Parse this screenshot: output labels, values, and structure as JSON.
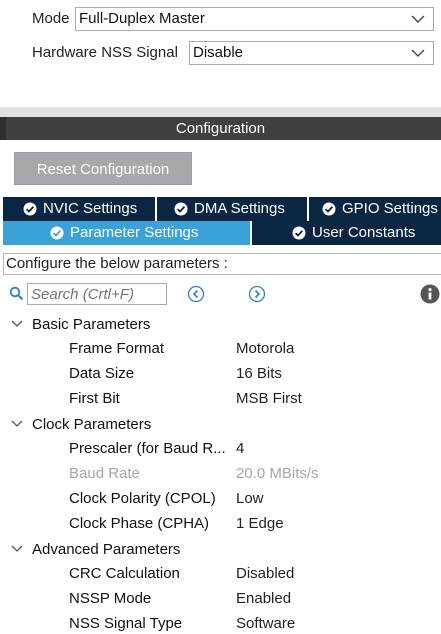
{
  "mode": {
    "label": "Mode",
    "value": "Full-Duplex Master"
  },
  "nss": {
    "label": "Hardware NSS Signal",
    "value": "Disable"
  },
  "configuration": {
    "title": "Configuration",
    "reset_label": "Reset Configuration"
  },
  "tabs": {
    "row1": [
      {
        "label": "NVIC Settings"
      },
      {
        "label": "DMA Settings"
      },
      {
        "label": "GPIO Settings"
      }
    ],
    "row2": [
      {
        "label": "Parameter Settings",
        "active": true
      },
      {
        "label": "User Constants"
      }
    ]
  },
  "description": "Configure the below parameters :",
  "search": {
    "placeholder": "Search (Crtl+F)"
  },
  "groups": [
    {
      "name": "Basic Parameters",
      "params": [
        {
          "name": "Frame Format",
          "value": "Motorola"
        },
        {
          "name": "Data Size",
          "value": "16 Bits"
        },
        {
          "name": "First Bit",
          "value": "MSB First"
        }
      ]
    },
    {
      "name": "Clock Parameters",
      "params": [
        {
          "name": "Prescaler (for Baud R...",
          "value": "4"
        },
        {
          "name": "Baud Rate",
          "value": "20.0 MBits/s",
          "disabled": true
        },
        {
          "name": "Clock Polarity (CPOL)",
          "value": "Low"
        },
        {
          "name": "Clock Phase (CPHA)",
          "value": "1 Edge"
        }
      ]
    },
    {
      "name": "Advanced Parameters",
      "params": [
        {
          "name": "CRC Calculation",
          "value": "Disabled"
        },
        {
          "name": "NSSP Mode",
          "value": "Enabled"
        },
        {
          "name": "NSS Signal Type",
          "value": "Software"
        }
      ]
    }
  ],
  "colors": {
    "tab_dark": "#0a2642",
    "tab_active": "#3aa1d9",
    "config_bar": "#3f4042",
    "reset_button": "#a7a8ab"
  }
}
